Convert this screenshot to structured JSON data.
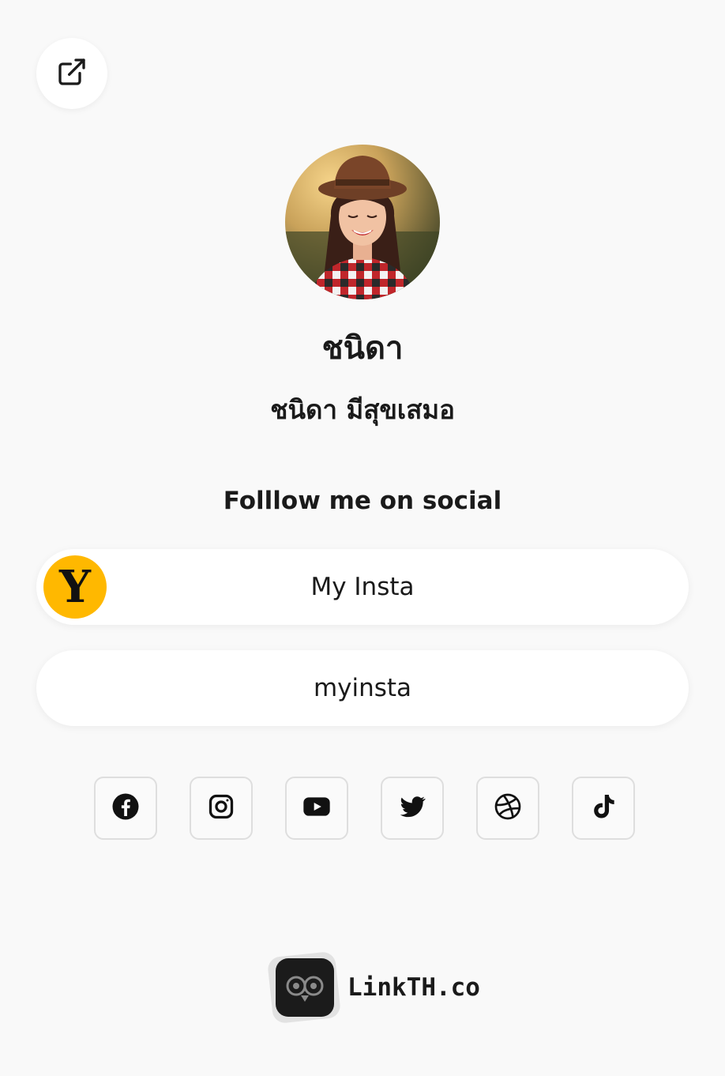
{
  "profile": {
    "name": "ชนิดา",
    "full_name": "ชนิดา มีสุขเสมอ"
  },
  "section": {
    "heading": "Folllow me on social"
  },
  "links": [
    {
      "label": "My Insta",
      "thumb_letter": "Y"
    },
    {
      "label": "myinsta"
    }
  ],
  "socials": [
    {
      "name": "facebook-icon"
    },
    {
      "name": "instagram-icon"
    },
    {
      "name": "youtube-icon"
    },
    {
      "name": "twitter-icon"
    },
    {
      "name": "dribbble-icon"
    },
    {
      "name": "tiktok-icon"
    }
  ],
  "footer": {
    "brand": "LinkTH.co"
  },
  "colors": {
    "background": "#f9f9f9",
    "thumb_accent": "#ffb800",
    "text": "#1a1a1a"
  }
}
